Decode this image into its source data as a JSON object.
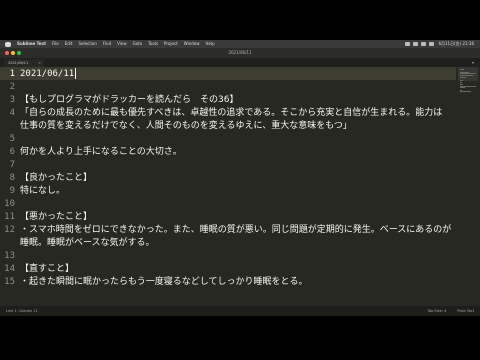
{
  "menubar": {
    "items": [
      "Sublime Text",
      "File",
      "Edit",
      "Selection",
      "Find",
      "View",
      "Goto",
      "Tools",
      "Project",
      "Window",
      "Help"
    ],
    "clock": "6月11日(金) 21:36"
  },
  "window": {
    "title": "2021/06/11"
  },
  "tabs": [
    {
      "label": "2021/06/11"
    }
  ],
  "editor": {
    "current_line": 1,
    "lines": [
      {
        "n": "1",
        "text": "2021/06/11"
      },
      {
        "n": "2",
        "text": ""
      },
      {
        "n": "3",
        "text": "【もしプログラマがドラッカーを読んだら　その36】"
      },
      {
        "n": "4",
        "text": "「自らの成長のために最も優先すべきは、卓越性の追求である。そこから充実と自信が生まれる。能力は"
      },
      {
        "n": "",
        "text": "仕事の質を変えるだけでなく、人間そのものを変えるゆえに、重大な意味をもつ」"
      },
      {
        "n": "5",
        "text": ""
      },
      {
        "n": "6",
        "text": "何かを人より上手になることの大切さ。"
      },
      {
        "n": "7",
        "text": ""
      },
      {
        "n": "8",
        "text": "【良かったこと】"
      },
      {
        "n": "9",
        "text": "特になし。"
      },
      {
        "n": "10",
        "text": ""
      },
      {
        "n": "11",
        "text": "【悪かったこと】"
      },
      {
        "n": "12",
        "text": "・スマホ時間をゼロにできなかった。また、睡眠の質が悪い。同じ問題が定期的に発生。ベースにあるのが"
      },
      {
        "n": "",
        "text": "睡眠。睡眠がベースな気がする。"
      },
      {
        "n": "13",
        "text": ""
      },
      {
        "n": "14",
        "text": "【直すこと】"
      },
      {
        "n": "15",
        "text": "・起きた瞬間に眠かったらもう一度寝るなどしてしっかり睡眠をとる。"
      }
    ]
  },
  "statusbar": {
    "position": "Line 1, Column 11",
    "tab_size": "Tab Size: 4",
    "syntax": "Plain Text"
  }
}
